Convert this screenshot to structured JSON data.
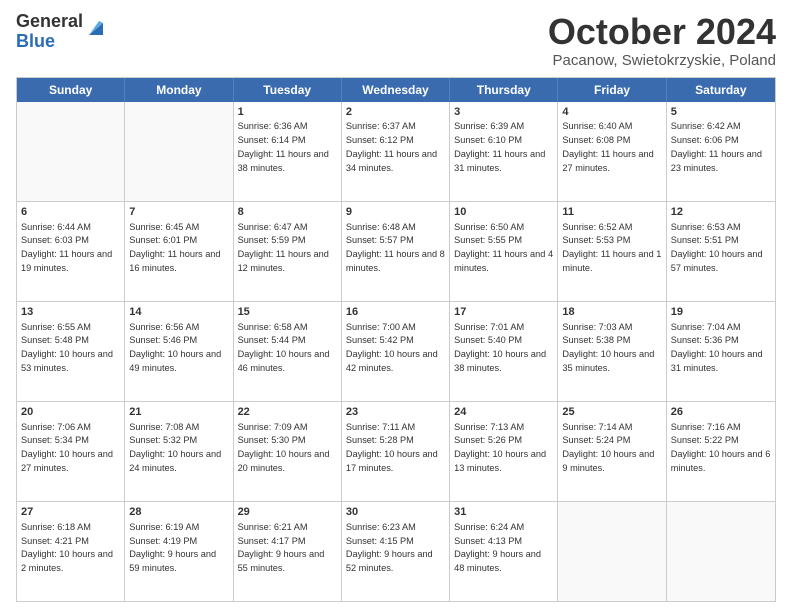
{
  "logo": {
    "general": "General",
    "blue": "Blue"
  },
  "title": "October 2024",
  "location": "Pacanow, Swietokrzyskie, Poland",
  "header_days": [
    "Sunday",
    "Monday",
    "Tuesday",
    "Wednesday",
    "Thursday",
    "Friday",
    "Saturday"
  ],
  "weeks": [
    [
      {
        "day": "",
        "sunrise": "",
        "sunset": "",
        "daylight": ""
      },
      {
        "day": "",
        "sunrise": "",
        "sunset": "",
        "daylight": ""
      },
      {
        "day": "1",
        "sunrise": "Sunrise: 6:36 AM",
        "sunset": "Sunset: 6:14 PM",
        "daylight": "Daylight: 11 hours and 38 minutes."
      },
      {
        "day": "2",
        "sunrise": "Sunrise: 6:37 AM",
        "sunset": "Sunset: 6:12 PM",
        "daylight": "Daylight: 11 hours and 34 minutes."
      },
      {
        "day": "3",
        "sunrise": "Sunrise: 6:39 AM",
        "sunset": "Sunset: 6:10 PM",
        "daylight": "Daylight: 11 hours and 31 minutes."
      },
      {
        "day": "4",
        "sunrise": "Sunrise: 6:40 AM",
        "sunset": "Sunset: 6:08 PM",
        "daylight": "Daylight: 11 hours and 27 minutes."
      },
      {
        "day": "5",
        "sunrise": "Sunrise: 6:42 AM",
        "sunset": "Sunset: 6:06 PM",
        "daylight": "Daylight: 11 hours and 23 minutes."
      }
    ],
    [
      {
        "day": "6",
        "sunrise": "Sunrise: 6:44 AM",
        "sunset": "Sunset: 6:03 PM",
        "daylight": "Daylight: 11 hours and 19 minutes."
      },
      {
        "day": "7",
        "sunrise": "Sunrise: 6:45 AM",
        "sunset": "Sunset: 6:01 PM",
        "daylight": "Daylight: 11 hours and 16 minutes."
      },
      {
        "day": "8",
        "sunrise": "Sunrise: 6:47 AM",
        "sunset": "Sunset: 5:59 PM",
        "daylight": "Daylight: 11 hours and 12 minutes."
      },
      {
        "day": "9",
        "sunrise": "Sunrise: 6:48 AM",
        "sunset": "Sunset: 5:57 PM",
        "daylight": "Daylight: 11 hours and 8 minutes."
      },
      {
        "day": "10",
        "sunrise": "Sunrise: 6:50 AM",
        "sunset": "Sunset: 5:55 PM",
        "daylight": "Daylight: 11 hours and 4 minutes."
      },
      {
        "day": "11",
        "sunrise": "Sunrise: 6:52 AM",
        "sunset": "Sunset: 5:53 PM",
        "daylight": "Daylight: 11 hours and 1 minute."
      },
      {
        "day": "12",
        "sunrise": "Sunrise: 6:53 AM",
        "sunset": "Sunset: 5:51 PM",
        "daylight": "Daylight: 10 hours and 57 minutes."
      }
    ],
    [
      {
        "day": "13",
        "sunrise": "Sunrise: 6:55 AM",
        "sunset": "Sunset: 5:48 PM",
        "daylight": "Daylight: 10 hours and 53 minutes."
      },
      {
        "day": "14",
        "sunrise": "Sunrise: 6:56 AM",
        "sunset": "Sunset: 5:46 PM",
        "daylight": "Daylight: 10 hours and 49 minutes."
      },
      {
        "day": "15",
        "sunrise": "Sunrise: 6:58 AM",
        "sunset": "Sunset: 5:44 PM",
        "daylight": "Daylight: 10 hours and 46 minutes."
      },
      {
        "day": "16",
        "sunrise": "Sunrise: 7:00 AM",
        "sunset": "Sunset: 5:42 PM",
        "daylight": "Daylight: 10 hours and 42 minutes."
      },
      {
        "day": "17",
        "sunrise": "Sunrise: 7:01 AM",
        "sunset": "Sunset: 5:40 PM",
        "daylight": "Daylight: 10 hours and 38 minutes."
      },
      {
        "day": "18",
        "sunrise": "Sunrise: 7:03 AM",
        "sunset": "Sunset: 5:38 PM",
        "daylight": "Daylight: 10 hours and 35 minutes."
      },
      {
        "day": "19",
        "sunrise": "Sunrise: 7:04 AM",
        "sunset": "Sunset: 5:36 PM",
        "daylight": "Daylight: 10 hours and 31 minutes."
      }
    ],
    [
      {
        "day": "20",
        "sunrise": "Sunrise: 7:06 AM",
        "sunset": "Sunset: 5:34 PM",
        "daylight": "Daylight: 10 hours and 27 minutes."
      },
      {
        "day": "21",
        "sunrise": "Sunrise: 7:08 AM",
        "sunset": "Sunset: 5:32 PM",
        "daylight": "Daylight: 10 hours and 24 minutes."
      },
      {
        "day": "22",
        "sunrise": "Sunrise: 7:09 AM",
        "sunset": "Sunset: 5:30 PM",
        "daylight": "Daylight: 10 hours and 20 minutes."
      },
      {
        "day": "23",
        "sunrise": "Sunrise: 7:11 AM",
        "sunset": "Sunset: 5:28 PM",
        "daylight": "Daylight: 10 hours and 17 minutes."
      },
      {
        "day": "24",
        "sunrise": "Sunrise: 7:13 AM",
        "sunset": "Sunset: 5:26 PM",
        "daylight": "Daylight: 10 hours and 13 minutes."
      },
      {
        "day": "25",
        "sunrise": "Sunrise: 7:14 AM",
        "sunset": "Sunset: 5:24 PM",
        "daylight": "Daylight: 10 hours and 9 minutes."
      },
      {
        "day": "26",
        "sunrise": "Sunrise: 7:16 AM",
        "sunset": "Sunset: 5:22 PM",
        "daylight": "Daylight: 10 hours and 6 minutes."
      }
    ],
    [
      {
        "day": "27",
        "sunrise": "Sunrise: 6:18 AM",
        "sunset": "Sunset: 4:21 PM",
        "daylight": "Daylight: 10 hours and 2 minutes."
      },
      {
        "day": "28",
        "sunrise": "Sunrise: 6:19 AM",
        "sunset": "Sunset: 4:19 PM",
        "daylight": "Daylight: 9 hours and 59 minutes."
      },
      {
        "day": "29",
        "sunrise": "Sunrise: 6:21 AM",
        "sunset": "Sunset: 4:17 PM",
        "daylight": "Daylight: 9 hours and 55 minutes."
      },
      {
        "day": "30",
        "sunrise": "Sunrise: 6:23 AM",
        "sunset": "Sunset: 4:15 PM",
        "daylight": "Daylight: 9 hours and 52 minutes."
      },
      {
        "day": "31",
        "sunrise": "Sunrise: 6:24 AM",
        "sunset": "Sunset: 4:13 PM",
        "daylight": "Daylight: 9 hours and 48 minutes."
      },
      {
        "day": "",
        "sunrise": "",
        "sunset": "",
        "daylight": ""
      },
      {
        "day": "",
        "sunrise": "",
        "sunset": "",
        "daylight": ""
      }
    ]
  ]
}
